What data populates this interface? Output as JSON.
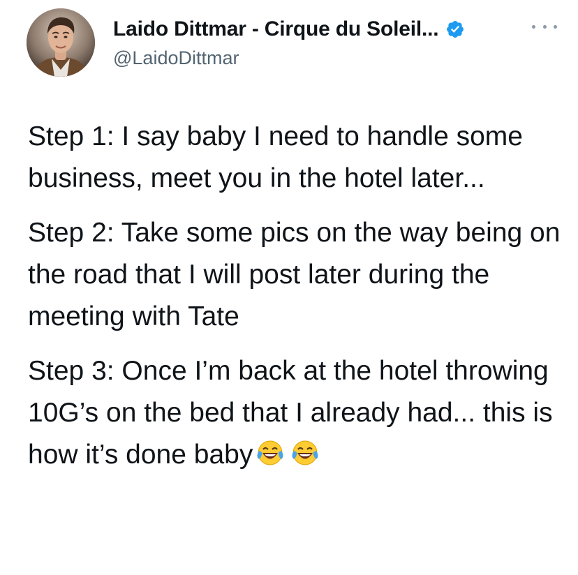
{
  "tweet": {
    "author": {
      "display_name": "Laido Dittmar - Cirque du Soleil...",
      "handle": "@LaidoDittmar",
      "verified": true,
      "verified_icon": "verified-badge-icon",
      "avatar_icon": "profile-photo"
    },
    "more_icon": "more-options-icon",
    "paragraphs": [
      "Step 1: I say baby I need to handle some business, meet you in the hotel later...",
      "Step 2: Take some pics on the way being on the road that I will post later during the meeting with Tate",
      "Step 3: Once I’m back at the hotel throwing 10G’s on the bed that I already had... this is how it’s done baby"
    ],
    "trailing_emoji": [
      "face-with-tears-of-joy",
      "face-with-tears-of-joy"
    ]
  },
  "colors": {
    "text": "#0f1419",
    "secondary_text": "#536471",
    "verified_blue": "#1d9bf0",
    "background": "#ffffff"
  }
}
